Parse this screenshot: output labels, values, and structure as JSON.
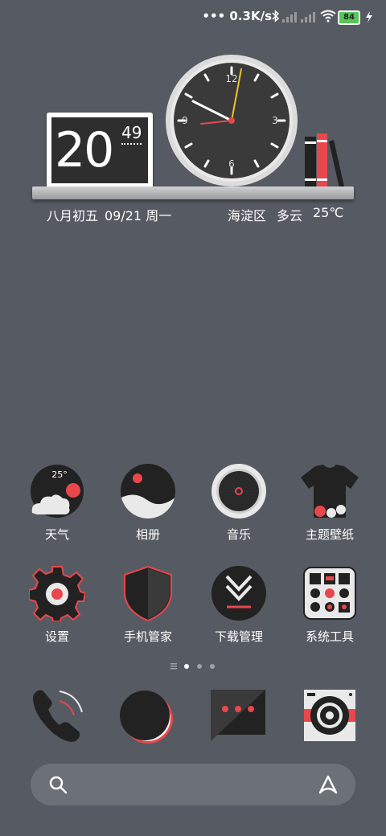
{
  "status_bar": {
    "network_speed": "0.3K/s",
    "battery_level": "84"
  },
  "widget": {
    "clock_hour": "20",
    "clock_minute": "49",
    "dial_numbers": [
      "12",
      "3",
      "6",
      "9"
    ],
    "lunar_date": "八月初五",
    "date": "09/21 周一",
    "location": "海淀区",
    "weather": "多云",
    "temperature": "25℃"
  },
  "apps_row1": [
    {
      "label": "天气",
      "badge": "25°"
    },
    {
      "label": "相册"
    },
    {
      "label": "音乐"
    },
    {
      "label": "主题壁纸"
    }
  ],
  "apps_row2": [
    {
      "label": "设置"
    },
    {
      "label": "手机管家"
    },
    {
      "label": "下载管理"
    },
    {
      "label": "系统工具"
    }
  ],
  "theme": {
    "accent": "#e8474c",
    "dark": "#222222",
    "bg": "#565a62"
  }
}
